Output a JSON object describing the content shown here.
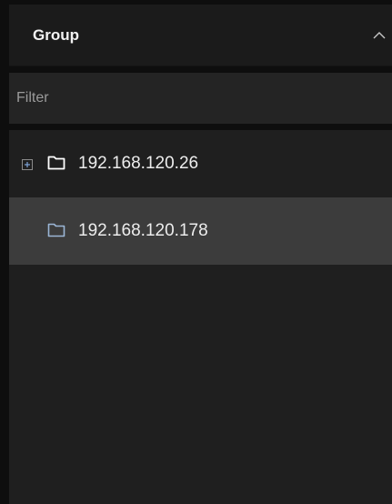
{
  "panel": {
    "title": "Group",
    "collapse_icon": "chevron-up-icon"
  },
  "filter": {
    "placeholder": "Filter",
    "value": ""
  },
  "tree": {
    "nodes": [
      {
        "label": "192.168.120.26",
        "icon": "folder-icon",
        "expander": "expand-plus-icon",
        "expanded": false,
        "selected": false
      },
      {
        "label": "192.168.120.178",
        "icon": "folder-icon",
        "selected": true
      }
    ]
  },
  "colors": {
    "header_bg": "#1b1b1b",
    "filter_bg": "#242424",
    "tree_bg": "#1f1f1f",
    "selected_bg": "#3c3c3c",
    "selected_folder": "#9bb6d6",
    "text": "#ededed"
  }
}
